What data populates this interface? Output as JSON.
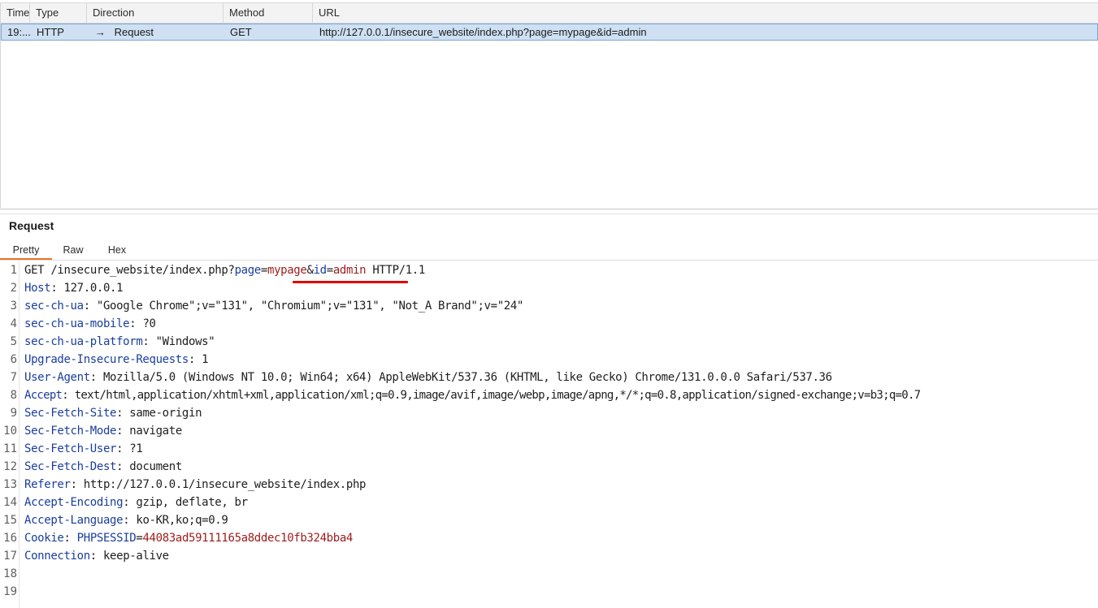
{
  "history": {
    "columns": {
      "time": "Time",
      "type": "Type",
      "direction": "Direction",
      "method": "Method",
      "url": "URL"
    },
    "rows": [
      {
        "time": "19:...",
        "type": "HTTP",
        "direction": "Request",
        "method": "GET",
        "url": "http://127.0.0.1/insecure_website/index.php?page=mypage&id=admin"
      }
    ]
  },
  "request_panel": {
    "title": "Request",
    "tabs": [
      "Pretty",
      "Raw",
      "Hex"
    ],
    "active_tab": "Pretty",
    "line_numbers": [
      "1",
      "2",
      "3",
      "4",
      "5",
      "6",
      "7",
      "8",
      "9",
      "10",
      "11",
      "12",
      "13",
      "14",
      "15",
      "16",
      "17",
      "18",
      "19"
    ],
    "request_line": {
      "method": "GET",
      "path": "/insecure_website/index.php?",
      "param1_name": "page",
      "param1_value": "mypage",
      "amp": "&",
      "param2_name": "id",
      "param2_value": "admin",
      "protocol": "HTTP/1.1"
    },
    "headers": [
      {
        "name": "Host",
        "value": "127.0.0.1"
      },
      {
        "name": "sec-ch-ua",
        "value": "\"Google Chrome\";v=\"131\", \"Chromium\";v=\"131\", \"Not_A Brand\";v=\"24\""
      },
      {
        "name": "sec-ch-ua-mobile",
        "value": "?0"
      },
      {
        "name": "sec-ch-ua-platform",
        "value": "\"Windows\""
      },
      {
        "name": "Upgrade-Insecure-Requests",
        "value": "1"
      },
      {
        "name": "User-Agent",
        "value": "Mozilla/5.0 (Windows NT 10.0; Win64; x64) AppleWebKit/537.36 (KHTML, like Gecko) Chrome/131.0.0.0 Safari/537.36"
      },
      {
        "name": "Accept",
        "value": "text/html,application/xhtml+xml,application/xml;q=0.9,image/avif,image/webp,image/apng,*/*;q=0.8,application/signed-exchange;v=b3;q=0.7"
      },
      {
        "name": "Sec-Fetch-Site",
        "value": "same-origin"
      },
      {
        "name": "Sec-Fetch-Mode",
        "value": "navigate"
      },
      {
        "name": "Sec-Fetch-User",
        "value": "?1"
      },
      {
        "name": "Sec-Fetch-Dest",
        "value": "document"
      },
      {
        "name": "Referer",
        "value": "http://127.0.0.1/insecure_website/index.php"
      },
      {
        "name": "Accept-Encoding",
        "value": "gzip, deflate, br"
      },
      {
        "name": "Accept-Language",
        "value": "ko-KR,ko;q=0.9"
      }
    ],
    "cookie": {
      "name": "Cookie",
      "cookie_name": "PHPSESSID",
      "cookie_value": "44083ad59111165a8ddec10fb324bba4"
    },
    "connection": {
      "name": "Connection",
      "value": "keep-alive"
    }
  },
  "colors": {
    "selected_row_bg": "#cfe0f3",
    "header_name": "#1a3e9c",
    "param_value": "#9e1b1b",
    "highlight_underline": "#e00000",
    "active_tab_indicator": "#e8762b"
  }
}
